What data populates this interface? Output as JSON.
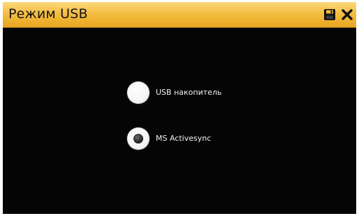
{
  "window": {
    "title": "Режим USB",
    "title_bg": "#f2b93a",
    "body_bg": "#050505"
  },
  "icons": {
    "save": "save-icon",
    "close": "close-icon"
  },
  "options": [
    {
      "label": "USB накопитель",
      "selected": false
    },
    {
      "label": "MS Activesync",
      "selected": true
    }
  ]
}
